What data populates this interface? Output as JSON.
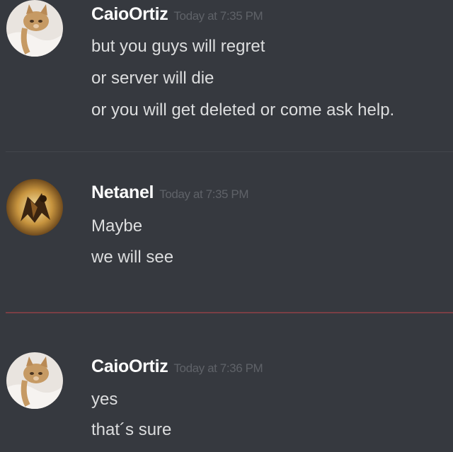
{
  "messages": [
    {
      "username": "CaioOrtiz",
      "timestamp": "Today at 7:35 PM",
      "avatar_icon": "cat-avatar-icon",
      "lines": [
        "but you guys will regret",
        "or server will die",
        "or you will get deleted or come ask help."
      ]
    },
    {
      "username": "Netanel",
      "timestamp": "Today at 7:35 PM",
      "avatar_icon": "warrior-avatar-icon",
      "lines": [
        "Maybe",
        "we will see"
      ]
    },
    {
      "username": "CaioOrtiz",
      "timestamp": "Today at 7:36 PM",
      "avatar_icon": "cat-avatar-icon",
      "lines": [
        "yes",
        "that´s sure"
      ]
    }
  ],
  "colors": {
    "background": "#36393f",
    "username": "#ffffff",
    "timestamp": "#5f6268",
    "message_text": "#dcddde",
    "new_messages_divider": "#7a3f45"
  }
}
